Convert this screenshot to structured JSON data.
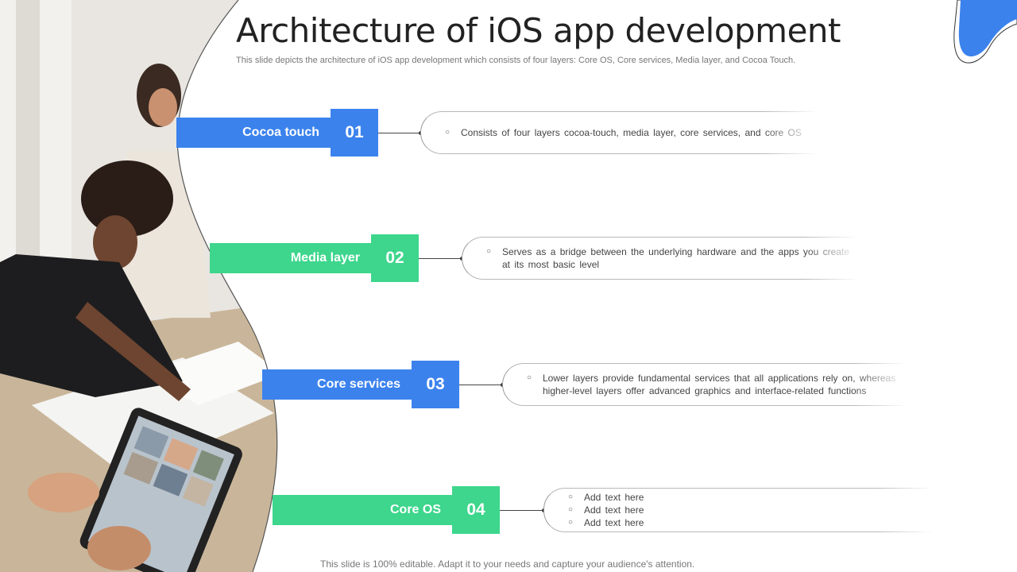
{
  "title": "Architecture of iOS app development",
  "subtitle": "This slide depicts the architecture of iOS app development which consists of four layers: Core OS, Core services, Media layer, and Cocoa Touch.",
  "footer": "This slide is 100% editable. Adapt it to your needs and capture your audience's attention.",
  "colors": {
    "blue": "#3b82ed",
    "green": "#3dd68c"
  },
  "layers": [
    {
      "label": "Cocoa touch",
      "number": "01",
      "color": "blue",
      "lines": [
        "Consists of four layers cocoa-touch, media layer, core services, and core OS"
      ]
    },
    {
      "label": "Media layer",
      "number": "02",
      "color": "green",
      "lines": [
        "Serves as a bridge between the underlying hardware and the apps you create at its most basic level"
      ]
    },
    {
      "label": "Core services",
      "number": "03",
      "color": "blue",
      "lines": [
        "Lower layers provide fundamental services that all applications rely on, whereas higher-level layers offer advanced graphics and interface-related functions"
      ]
    },
    {
      "label": "Core OS",
      "number": "04",
      "color": "green",
      "lines": [
        "Add text here",
        "Add text here",
        "Add text here"
      ]
    }
  ]
}
